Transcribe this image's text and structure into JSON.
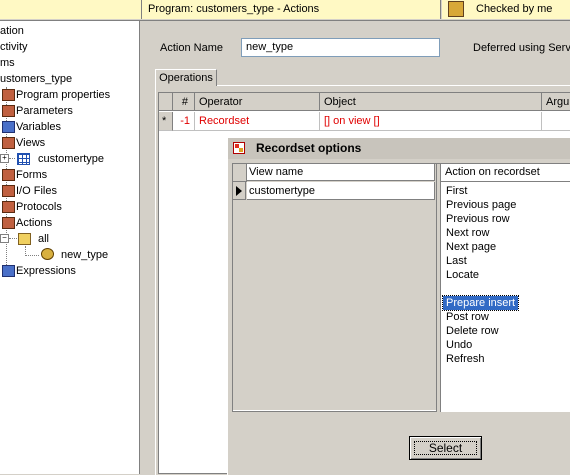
{
  "topbar": {
    "program_label": "Program: customers_type - Actions",
    "checked_label": "Checked by me"
  },
  "tree": {
    "items": [
      {
        "label": "ation"
      },
      {
        "label": "ctivity"
      },
      {
        "label": "ms"
      },
      {
        "label": "ustomers_type"
      },
      {
        "label": "Program properties"
      },
      {
        "label": "Parameters"
      },
      {
        "label": "Variables"
      },
      {
        "label": "Views"
      },
      {
        "label": "customertype"
      },
      {
        "label": "Forms"
      },
      {
        "label": "I/O Files"
      },
      {
        "label": "Protocols"
      },
      {
        "label": "Actions"
      },
      {
        "label": "all"
      },
      {
        "label": "new_type"
      },
      {
        "label": "Expressions"
      }
    ]
  },
  "action_form": {
    "name_label": "Action Name",
    "name_value": "new_type",
    "deferred_label": "Deferred using Servi"
  },
  "tabs": [
    {
      "label": "Operations"
    }
  ],
  "operations_grid": {
    "headers": [
      "#",
      "Operator",
      "Object",
      "Argu"
    ],
    "rows": [
      {
        "marker": "*",
        "num": "-1",
        "operator": "Recordset",
        "object": "[] on view []",
        "argument": ""
      }
    ]
  },
  "dialog": {
    "title": "Recordset options",
    "view_header": "View name",
    "views": [
      "customertype"
    ],
    "action_header": "Action on recordset",
    "actions": [
      "First",
      "Previous page",
      "Previous row",
      "Next row",
      "Next page",
      "Last",
      "Locate",
      "",
      "Prepare insert",
      "Post row",
      "Delete row",
      "Undo",
      "Refresh"
    ],
    "selected_action": "Prepare insert",
    "select_button": "Select"
  },
  "colors": {
    "accent_selection": "#316ac5",
    "error_red": "#e00000",
    "topbar_bg": "#fff9c4"
  }
}
